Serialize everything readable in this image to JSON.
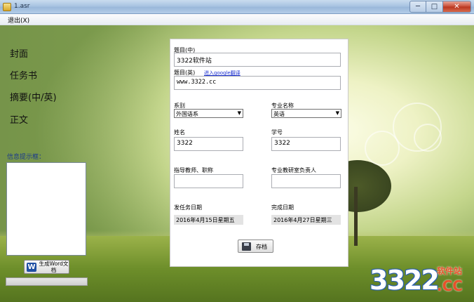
{
  "window": {
    "title": "1.asr",
    "min_glyph": "─",
    "max_glyph": "□",
    "close_glyph": "✕"
  },
  "menu": {
    "exit": "退出(X)"
  },
  "nav": {
    "cover": "封面",
    "task": "任务书",
    "abstract": "摘要(中/英)",
    "body": "正文"
  },
  "info": {
    "label": "信息提示框："
  },
  "generate": {
    "label": "生成Word文档",
    "icon_glyph": "W"
  },
  "progress": {
    "value": 0
  },
  "form": {
    "title_cn": {
      "label": "题目(中)",
      "value": "3322软件站"
    },
    "title_en": {
      "label": "题目(英)",
      "link": "进入google翻译",
      "value": "www.3322.cc"
    },
    "department": {
      "label": "系别",
      "selected": "外国语系"
    },
    "major": {
      "label": "专业名称",
      "selected": "英语"
    },
    "name": {
      "label": "姓名",
      "value": "3322"
    },
    "student_id": {
      "label": "学号",
      "value": "3322"
    },
    "advisor": {
      "label": "指导教师、职称",
      "value": ""
    },
    "office_head": {
      "label": "专业教研室负责人",
      "value": ""
    },
    "issue_date": {
      "label": "发任务日期",
      "value": "2016年4月15日星期五"
    },
    "finish_date": {
      "label": "完成日期",
      "value": "2016年4月27日星期三"
    },
    "save": {
      "label": "存档"
    },
    "dropdown_glyph": "▼"
  },
  "watermark": {
    "number": "3322",
    "cn": "软件站",
    "cc": ".CC"
  }
}
